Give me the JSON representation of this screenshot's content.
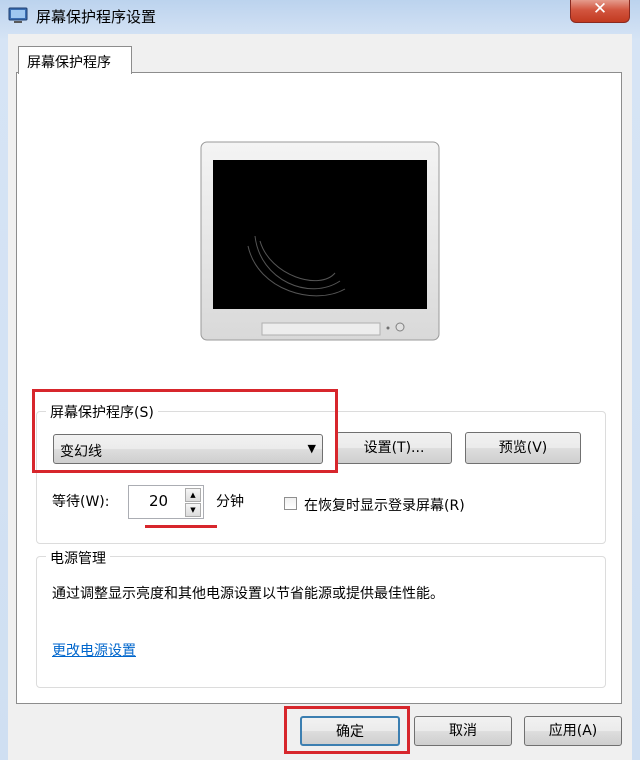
{
  "window": {
    "title": "屏幕保护程序设置",
    "close_glyph": "✕"
  },
  "tab": {
    "label": "屏幕保护程序"
  },
  "screensaver": {
    "group_label": "屏幕保护程序(S)",
    "selected": "变幻线",
    "settings_button": "设置(T)...",
    "preview_button": "预览(V)",
    "wait_label": "等待(W):",
    "wait_value": "20",
    "wait_unit": "分钟",
    "resume_checkbox_label": "在恢复时显示登录屏幕(R)",
    "resume_checked": false
  },
  "power": {
    "group_label": "电源管理",
    "description": "通过调整显示亮度和其他电源设置以节省能源或提供最佳性能。",
    "link": "更改电源设置"
  },
  "footer": {
    "ok": "确定",
    "cancel": "取消",
    "apply": "应用(A)"
  },
  "colors": {
    "highlight_red": "#d7262c",
    "link_blue": "#0066cc"
  }
}
